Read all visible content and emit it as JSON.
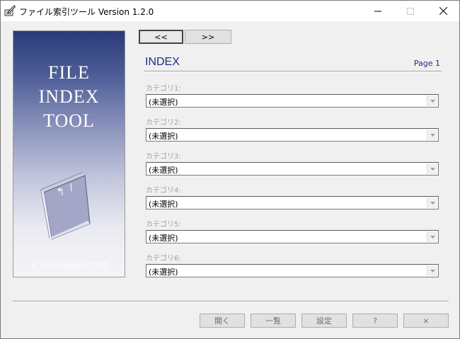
{
  "window": {
    "title": "ファイル索引ツール  Version 1.2.0",
    "icon": "pen-note-icon"
  },
  "splash": {
    "line1": "FILE",
    "line2": "INDEX",
    "line3": "TOOL",
    "copyright": "© Koichi Asawa 2007"
  },
  "nav": {
    "prev_label": "<<",
    "next_label": ">>"
  },
  "index": {
    "title": "INDEX",
    "page": "Page 1"
  },
  "categories": [
    {
      "label": "カテゴリ1:",
      "value": "(未選択)"
    },
    {
      "label": "カテゴリ2:",
      "value": "(未選択)"
    },
    {
      "label": "カテゴリ3:",
      "value": "(未選択)"
    },
    {
      "label": "カテゴリ4:",
      "value": "(未選択)"
    },
    {
      "label": "カテゴリ5:",
      "value": "(未選択)"
    },
    {
      "label": "カテゴリ6:",
      "value": "(未選択)"
    }
  ],
  "buttons": {
    "open": "開く",
    "list": "一覧",
    "settings": "設定",
    "help": "?",
    "close": "×"
  },
  "colors": {
    "accent_text": "#1e2a8c",
    "disabled_text": "#a0a0a0",
    "splash_top": "#2a3b78"
  }
}
